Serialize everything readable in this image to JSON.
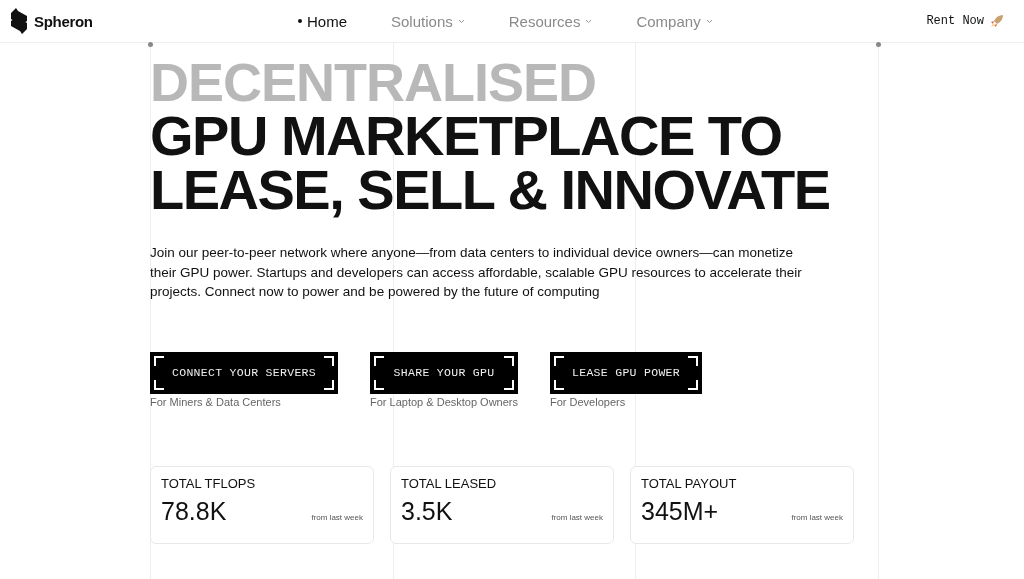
{
  "brand": {
    "name": "Spheron"
  },
  "nav": [
    {
      "label": "Home",
      "selected": true,
      "dropdown": false
    },
    {
      "label": "Solutions",
      "selected": false,
      "dropdown": true
    },
    {
      "label": "Resources",
      "selected": false,
      "dropdown": true
    },
    {
      "label": "Company",
      "selected": false,
      "dropdown": true
    }
  ],
  "cta": {
    "label": "Rent Now"
  },
  "hero": {
    "backdrop": "DECENTRALISED",
    "headline": [
      "GPU MARKETPLACE TO",
      "LEASE, SELL & INNOVATE"
    ],
    "description": "Join our peer-to-peer network where anyone—from data centers to individual device owners—can monetize their GPU power. Startups and developers can access affordable, scalable GPU resources to accelerate their projects. Connect now to power and be powered by the future of computing"
  },
  "actions": [
    {
      "label": "CONNECT YOUR SERVERS",
      "caption": "For Miners & Data Centers"
    },
    {
      "label": "SHARE YOUR GPU",
      "caption": "For Laptop & Desktop Owners"
    },
    {
      "label": "LEASE GPU POWER",
      "caption": "For Developers"
    }
  ],
  "stats": [
    {
      "label": "TOTAL TFLOPS",
      "value": "78.8K",
      "note": "from last week"
    },
    {
      "label": "TOTAL LEASED",
      "value": "3.5K",
      "note": "from last week"
    },
    {
      "label": "TOTAL PAYOUT",
      "value": "345M+",
      "note": "from last week"
    }
  ]
}
